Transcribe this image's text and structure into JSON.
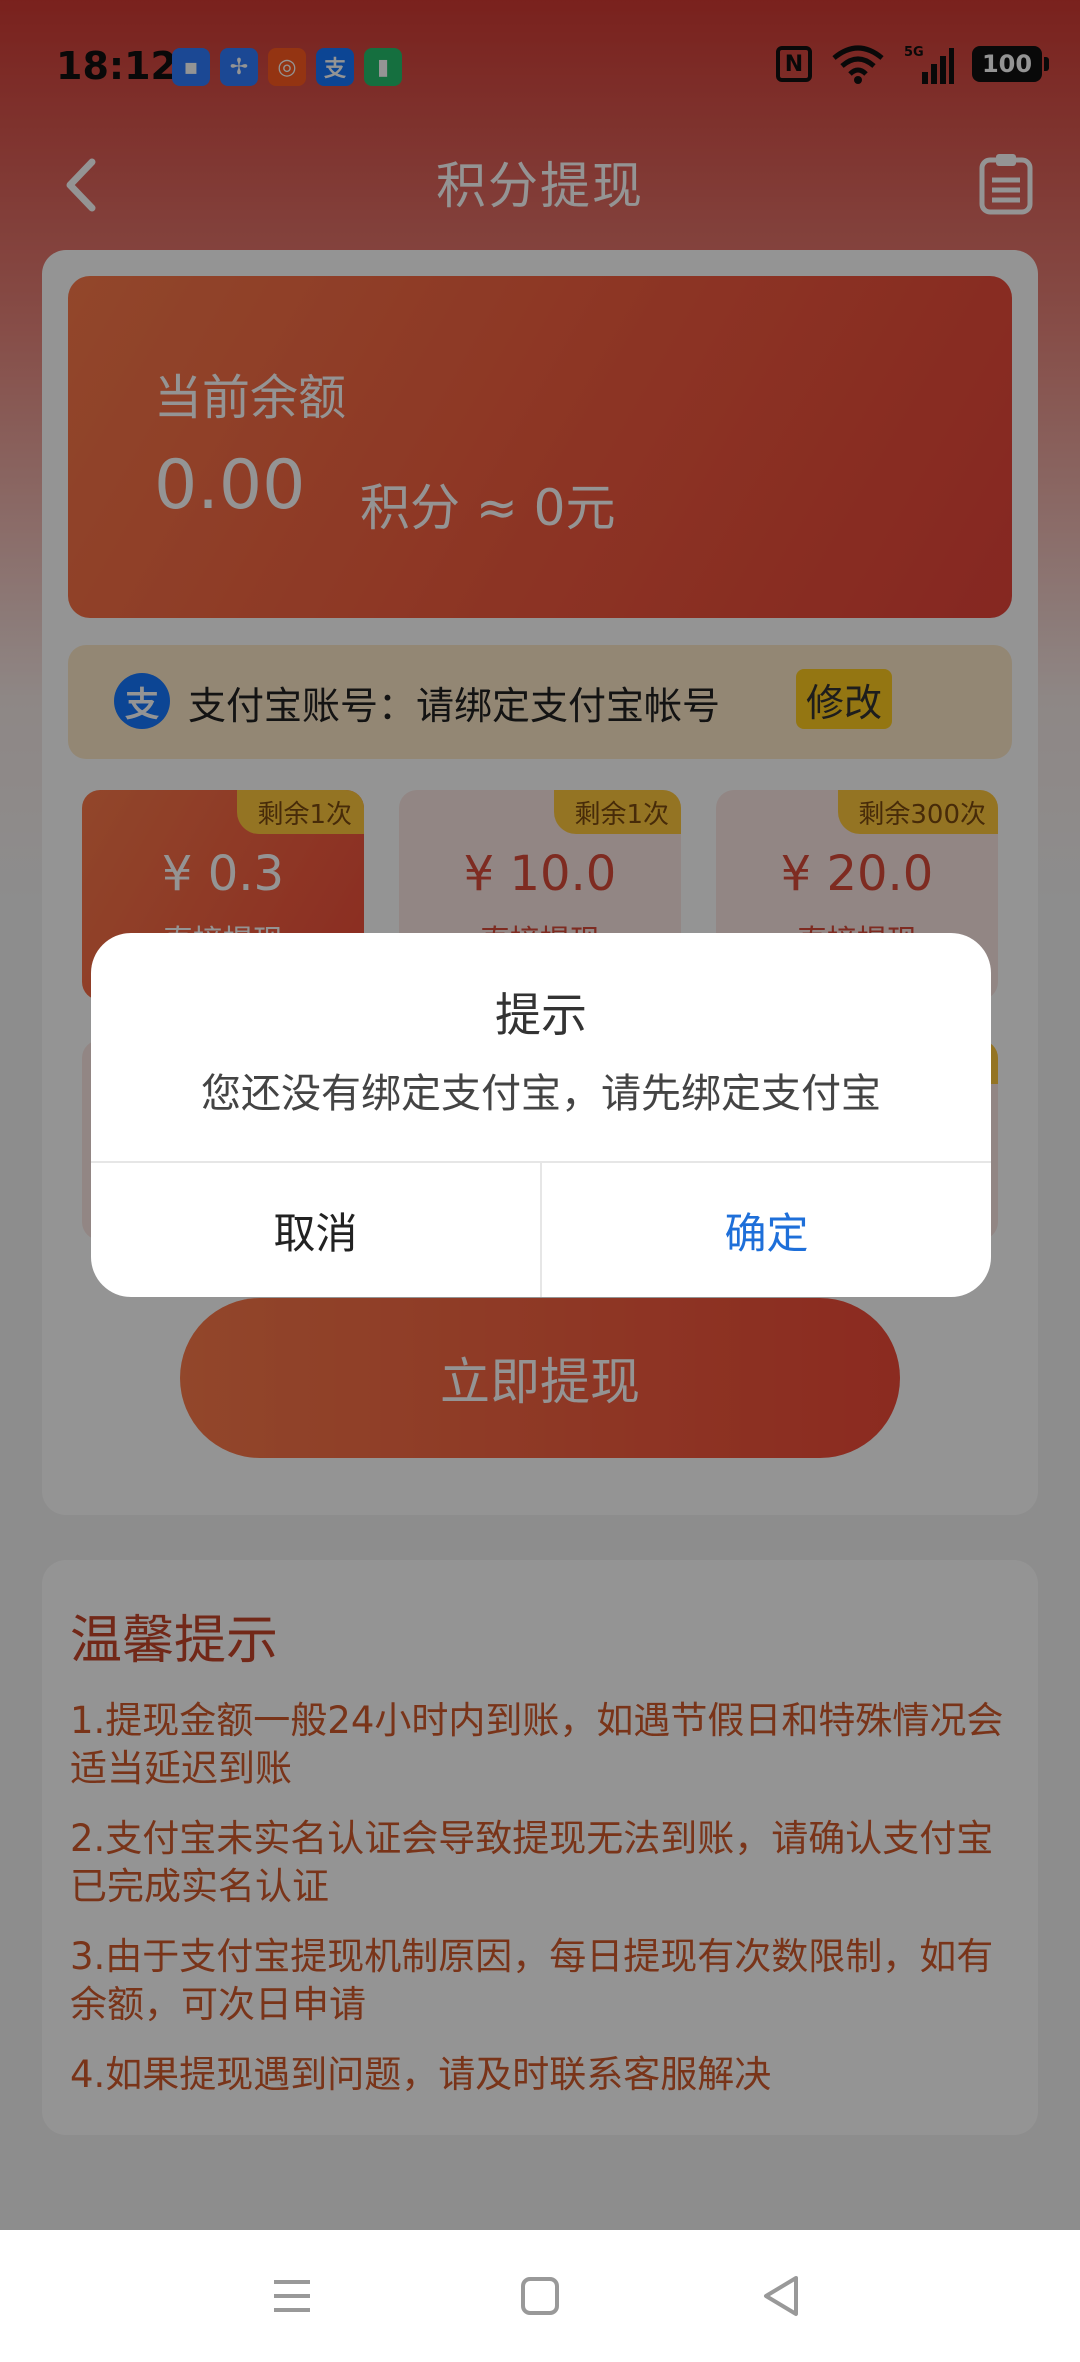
{
  "status_bar": {
    "time": "18:12",
    "battery": "100",
    "notification_icons": [
      "message-icon",
      "pinwheel-icon",
      "taobao-icon",
      "alipay-icon",
      "battery-saver-icon"
    ],
    "signal_label": "5G"
  },
  "header": {
    "title": "积分提现",
    "back_icon": "chevron-left-icon",
    "record_icon": "clipboard-icon"
  },
  "balance": {
    "label": "当前余额",
    "amount": "0.00",
    "unit_text": "积分 ≈ 0元"
  },
  "alipay": {
    "icon_text": "支",
    "account_text": "支付宝账号：请绑定支付宝帐号",
    "modify_label": "修改"
  },
  "options": [
    {
      "badge": "剩余1次",
      "price": "¥ 0.3",
      "sub": "直接提现",
      "selected": true
    },
    {
      "badge": "剩余1次",
      "price": "¥ 10.0",
      "sub": "直接提现",
      "selected": false
    },
    {
      "badge": "剩余300次",
      "price": "¥ 20.0",
      "sub": "直接提现",
      "selected": false
    }
  ],
  "withdraw_button": "立即提现",
  "tips": {
    "title": "温馨提示",
    "items": [
      "1.提现金额一般24小时内到账，如遇节假日和特殊情况会适当延迟到账",
      "2.支付宝未实名认证会导致提现无法到账，请确认支付宝已完成实名认证",
      "3.由于支付宝提现机制原因，每日提现有次数限制，如有余额，可次日申请",
      "4.如果提现遇到问题，请及时联系客服解决"
    ]
  },
  "dialog": {
    "title": "提示",
    "message": "您还没有绑定支付宝，请先绑定支付宝",
    "cancel": "取消",
    "confirm": "确定"
  },
  "colors": {
    "accent": "#f25a3e",
    "dialog_confirm": "#1e6fd9",
    "badge": "#ffc93d",
    "modify": "#ffcc1f"
  }
}
